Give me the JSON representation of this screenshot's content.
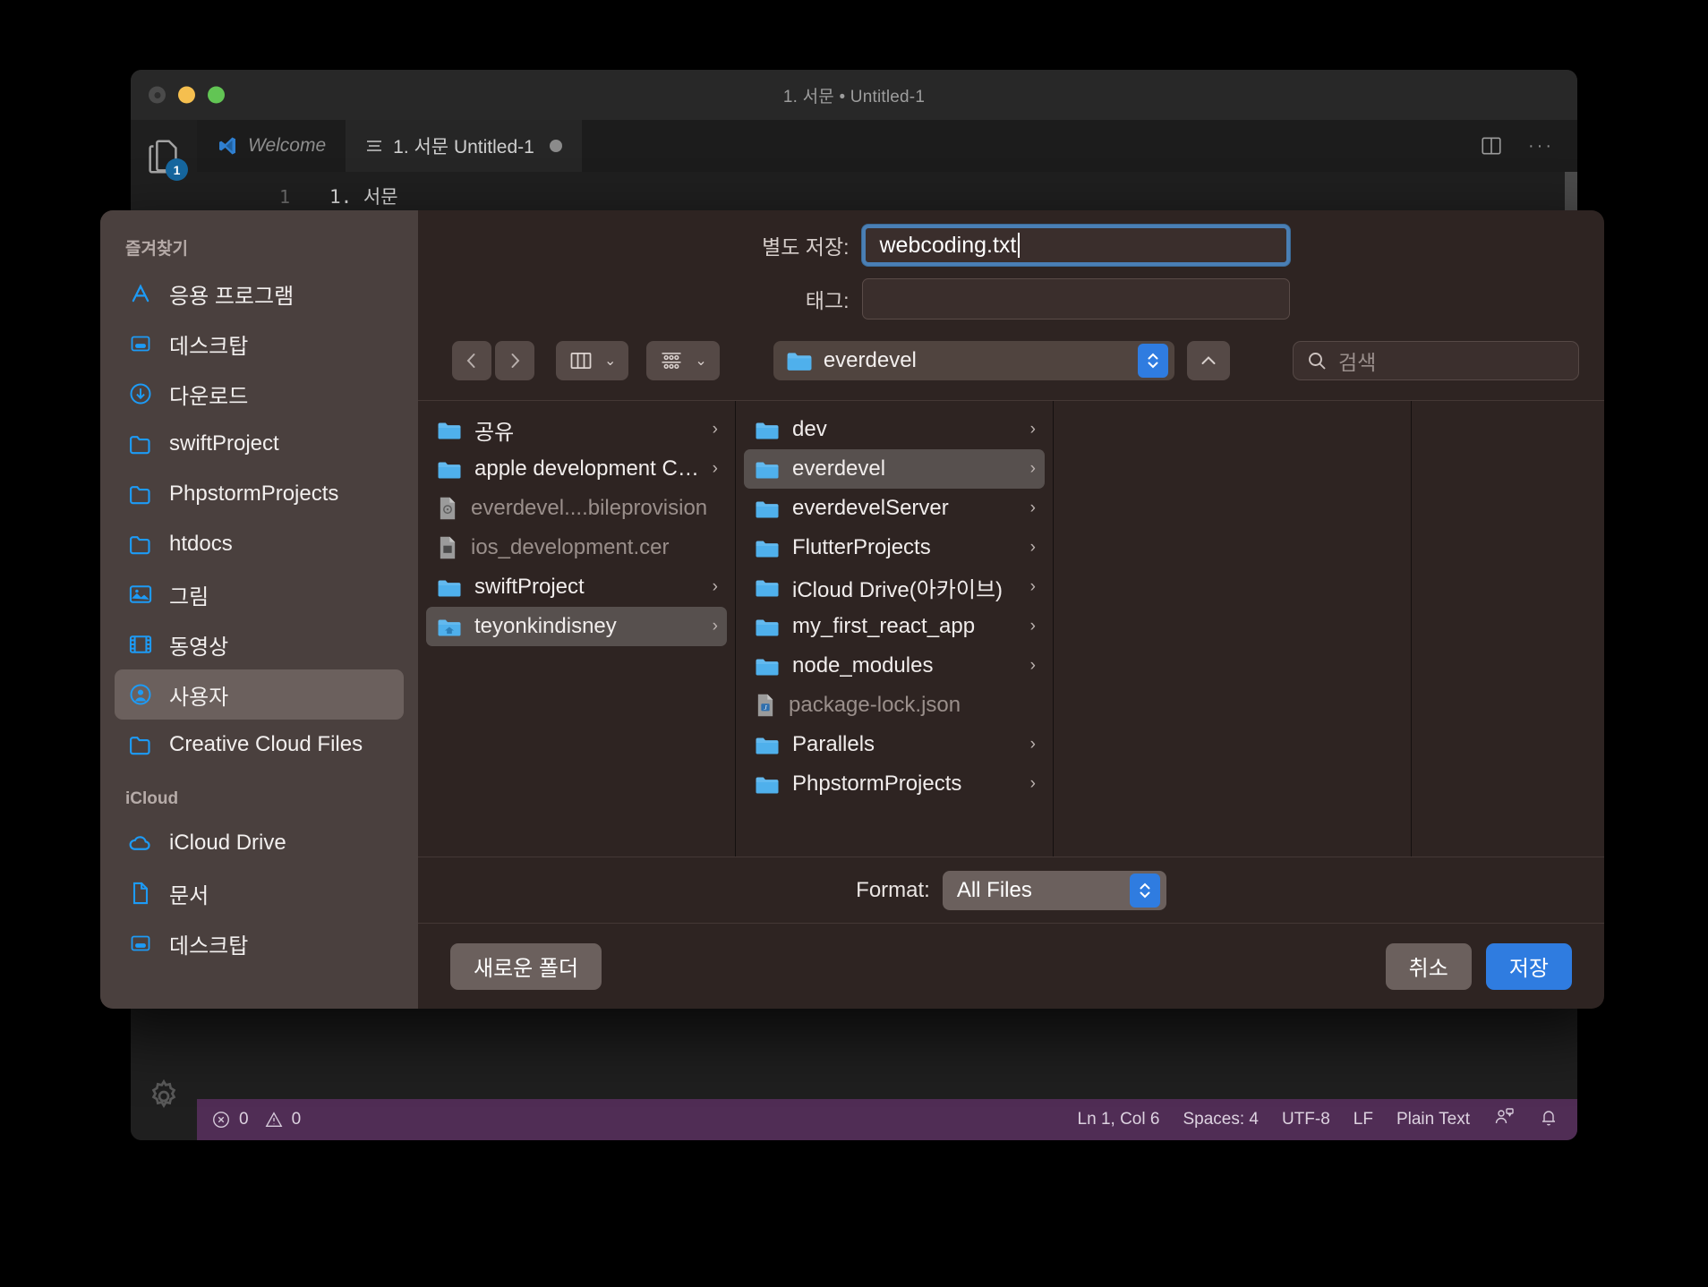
{
  "window": {
    "title": "1. 서문 • Untitled-1",
    "traffic": [
      "close-button",
      "minimize-button",
      "maximize-button"
    ],
    "activity_badge": "1"
  },
  "tabs": [
    {
      "label": "Welcome",
      "icon": "vscode-logo-icon",
      "active": false,
      "dirty": false
    },
    {
      "label": "1. 서문  Untitled-1",
      "icon": "lines-icon",
      "active": true,
      "dirty": true
    }
  ],
  "editor": {
    "line_number": "1",
    "line_text": "1. 서문"
  },
  "editor_actions": {
    "split_label": "split-editor-right",
    "more_label": "···"
  },
  "statusbar": {
    "errors": "0",
    "warnings": "0",
    "items": [
      "Ln 1, Col 6",
      "Spaces: 4",
      "UTF-8",
      "LF",
      "Plain Text"
    ],
    "background": "#502d55"
  },
  "dialog": {
    "save_as_label": "별도 저장:",
    "filename": "webcoding.txt",
    "tags_label": "태그:",
    "tags_value": "",
    "accent": "#2f7ce0",
    "sidebar": {
      "groups": [
        {
          "title": "즐겨찾기",
          "items": [
            {
              "label": "응용 프로그램",
              "icon": "applications-icon",
              "selected": false
            },
            {
              "label": "데스크탑",
              "icon": "desktop-icon",
              "selected": false
            },
            {
              "label": "다운로드",
              "icon": "downloads-icon",
              "selected": false
            },
            {
              "label": "swiftProject",
              "icon": "folder-icon",
              "selected": false
            },
            {
              "label": "PhpstormProjects",
              "icon": "folder-icon",
              "selected": false
            },
            {
              "label": "htdocs",
              "icon": "folder-icon",
              "selected": false
            },
            {
              "label": "그림",
              "icon": "pictures-icon",
              "selected": false
            },
            {
              "label": "동영상",
              "icon": "movies-icon",
              "selected": false
            },
            {
              "label": "사용자",
              "icon": "user-icon",
              "selected": true
            },
            {
              "label": "Creative Cloud Files",
              "icon": "folder-icon",
              "selected": false
            }
          ]
        },
        {
          "title": "iCloud",
          "items": [
            {
              "label": "iCloud Drive",
              "icon": "cloud-icon",
              "selected": false
            },
            {
              "label": "문서",
              "icon": "document-icon",
              "selected": false
            },
            {
              "label": "데스크탑",
              "icon": "desktop-icon",
              "selected": false
            }
          ]
        }
      ]
    },
    "toolbar": {
      "back": "‹",
      "forward": "›",
      "view_column_icon": "column-view-icon",
      "view_group_icon": "group-view-icon",
      "path_label": "everdevel",
      "up_icon": "chevron-up-icon",
      "search_placeholder": "검색",
      "search_value": ""
    },
    "columns": [
      {
        "items": [
          {
            "name": "공유",
            "type": "folder",
            "arrow": true,
            "selected": false,
            "dim": false
          },
          {
            "name": "apple development Cert",
            "type": "folder",
            "arrow": true,
            "selected": false,
            "dim": false
          },
          {
            "name": "everdevel....bileprovision",
            "type": "provision-file",
            "arrow": false,
            "selected": false,
            "dim": true
          },
          {
            "name": "ios_development.cer",
            "type": "cert-file",
            "arrow": false,
            "selected": false,
            "dim": true
          },
          {
            "name": "swiftProject",
            "type": "folder",
            "arrow": true,
            "selected": false,
            "dim": false
          },
          {
            "name": "teyonkindisney",
            "type": "home-folder",
            "arrow": true,
            "selected": true,
            "dim": false
          }
        ]
      },
      {
        "items": [
          {
            "name": "dev",
            "type": "folder",
            "arrow": true,
            "selected": false,
            "dim": false
          },
          {
            "name": "everdevel",
            "type": "folder",
            "arrow": true,
            "selected": true,
            "dim": false
          },
          {
            "name": "everdevelServer",
            "type": "folder",
            "arrow": true,
            "selected": false,
            "dim": false
          },
          {
            "name": "FlutterProjects",
            "type": "folder",
            "arrow": true,
            "selected": false,
            "dim": false
          },
          {
            "name": "iCloud Drive(아카이브)",
            "type": "folder",
            "arrow": true,
            "selected": false,
            "dim": false
          },
          {
            "name": "my_first_react_app",
            "type": "folder",
            "arrow": true,
            "selected": false,
            "dim": false
          },
          {
            "name": "node_modules",
            "type": "folder",
            "arrow": true,
            "selected": false,
            "dim": false
          },
          {
            "name": "package-lock.json",
            "type": "json-file",
            "arrow": false,
            "selected": false,
            "dim": true
          },
          {
            "name": "Parallels",
            "type": "folder",
            "arrow": true,
            "selected": false,
            "dim": false
          },
          {
            "name": "PhpstormProjects",
            "type": "folder",
            "arrow": true,
            "selected": false,
            "dim": false
          }
        ]
      },
      {
        "items": []
      },
      {
        "items": []
      }
    ],
    "format_label": "Format:",
    "format_value": "All Files",
    "new_folder_label": "새로운 폴더",
    "cancel_label": "취소",
    "save_label": "저장"
  }
}
